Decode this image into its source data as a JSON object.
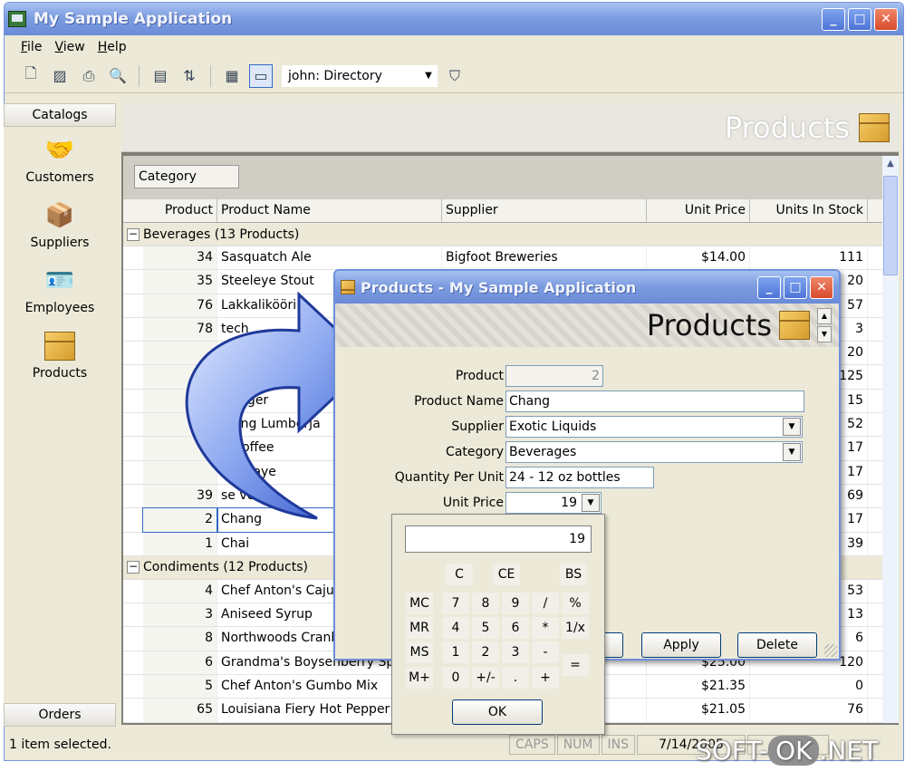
{
  "app": {
    "title": "My Sample Application"
  },
  "menu": [
    {
      "key": "F",
      "rest": "ile"
    },
    {
      "key": "V",
      "rest": "iew"
    },
    {
      "key": "H",
      "rest": "elp"
    }
  ],
  "toolbar": {
    "combo_value": "john: Directory"
  },
  "left_nav": {
    "catalogs_label": "Catalogs",
    "items": [
      {
        "label": "Customers",
        "icon": "handshake-icon"
      },
      {
        "label": "Suppliers",
        "icon": "supplier-box-icon"
      },
      {
        "label": "Employees",
        "icon": "employee-card-icon"
      },
      {
        "label": "Products",
        "icon": "product-box-icon"
      }
    ],
    "orders_label": "Orders"
  },
  "main": {
    "banner_title": "Products",
    "group_by": "Category",
    "columns": [
      "Product",
      "Product Name",
      "Supplier",
      "Unit Price",
      "Units In Stock"
    ],
    "groups": [
      {
        "label": "Beverages (13 Products)",
        "rows": [
          {
            "id": "34",
            "name": "Sasquatch Ale",
            "supplier": "Bigfoot Breweries",
            "price": "$14.00",
            "stock": "111"
          },
          {
            "id": "35",
            "name": "Steeleye Stout",
            "supplier": "",
            "price": "",
            "stock": "20"
          },
          {
            "id": "76",
            "name": "Lakkalikööri",
            "supplier": "",
            "price": "",
            "stock": "57"
          },
          {
            "id": "78",
            "name": "tech",
            "supplier": "",
            "price": "",
            "stock": "3"
          },
          {
            "id": "",
            "name": "",
            "supplier": "",
            "price": "",
            "stock": "20"
          },
          {
            "id": "",
            "name": "",
            "supplier": "",
            "price": "",
            "stock": "125"
          },
          {
            "id": "",
            "name": "k Lager",
            "supplier": "",
            "price": "",
            "stock": "15"
          },
          {
            "id": "",
            "name": "ghing Lumberja",
            "supplier": "",
            "price": "",
            "stock": "52"
          },
          {
            "id": "",
            "name": "n Coffee",
            "supplier": "",
            "price": "",
            "stock": "17"
          },
          {
            "id": "",
            "name": "de Blaye",
            "supplier": "",
            "price": "",
            "stock": "17"
          },
          {
            "id": "39",
            "name": "se verte",
            "supplier": "",
            "price": "",
            "stock": "69"
          },
          {
            "id": "2",
            "name": "Chang",
            "supplier": "",
            "price": "",
            "stock": "17"
          },
          {
            "id": "1",
            "name": "Chai",
            "supplier": "",
            "price": "",
            "stock": "39"
          }
        ]
      },
      {
        "label": "Condiments (12 Products)",
        "rows": [
          {
            "id": "4",
            "name": "Chef Anton's Cajun",
            "supplier": "",
            "price": "",
            "stock": "53"
          },
          {
            "id": "3",
            "name": "Aniseed Syrup",
            "supplier": "",
            "price": "",
            "stock": "13"
          },
          {
            "id": "8",
            "name": "Northwoods Cranb",
            "supplier": "",
            "price": "",
            "stock": "6"
          },
          {
            "id": "6",
            "name": "Grandma's Boysenberry Spr",
            "supplier": "",
            "price": "$25.00",
            "stock": "120"
          },
          {
            "id": "5",
            "name": "Chef Anton's Gumbo Mix",
            "supplier": "ts",
            "price": "$21.35",
            "stock": "0"
          },
          {
            "id": "65",
            "name": "Louisiana Fiery Hot Pepper S",
            "supplier": "ts",
            "price": "$21.05",
            "stock": "76"
          }
        ]
      }
    ]
  },
  "status": {
    "left": "1 item selected.",
    "caps": "CAPS",
    "num": "NUM",
    "ins": "INS",
    "date": "7/14/2005",
    "user": "john"
  },
  "dialog": {
    "title": "Products - My Sample Application",
    "banner_title": "Products",
    "fields": {
      "product_label": "Product",
      "product_value": "2",
      "name_label": "Product Name",
      "name_value": "Chang",
      "supplier_label": "Supplier",
      "supplier_value": "Exotic Liquids",
      "category_label": "Category",
      "category_value": "Beverages",
      "qty_label": "Quantity Per Unit",
      "qty_value": "24 - 12 oz bottles",
      "price_label": "Unit Price",
      "price_value": "19"
    },
    "apply_label": "Apply",
    "delete_label": "Delete"
  },
  "calculator": {
    "display": "19",
    "keys": [
      "C",
      "CE",
      "BS",
      "MC",
      "7",
      "8",
      "9",
      "/",
      "%",
      "MR",
      "4",
      "5",
      "6",
      "*",
      "1/x",
      "MS",
      "1",
      "2",
      "3",
      "-",
      "M+",
      "0",
      "+/-",
      ".",
      "+",
      "="
    ],
    "ok_label": "OK"
  },
  "watermark": {
    "left": "SOFT-",
    "mid": "OK",
    "right": ".NET"
  }
}
